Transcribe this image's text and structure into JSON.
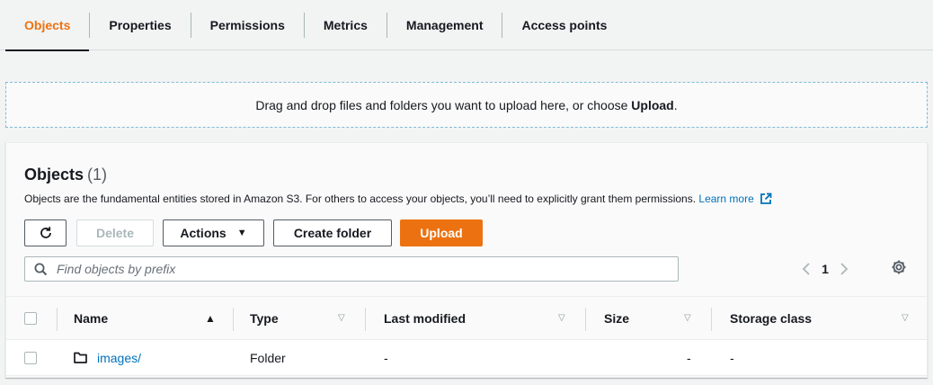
{
  "tabs": [
    {
      "label": "Objects"
    },
    {
      "label": "Properties"
    },
    {
      "label": "Permissions"
    },
    {
      "label": "Metrics"
    },
    {
      "label": "Management"
    },
    {
      "label": "Access points"
    }
  ],
  "dropzone": {
    "text": "Drag and drop files and folders you want to upload here, or choose ",
    "bold": "Upload",
    "suffix": "."
  },
  "objects": {
    "title": "Objects",
    "count": "(1)",
    "description": "Objects are the fundamental entities stored in Amazon S3. For others to access your objects, you’ll need to explicitly grant them permissions.",
    "learn_more": "Learn more",
    "buttons": {
      "delete": "Delete",
      "actions": "Actions",
      "create_folder": "Create folder",
      "upload": "Upload"
    },
    "search": {
      "placeholder": "Find objects by prefix",
      "value": ""
    },
    "pagination": {
      "page": "1"
    },
    "columns": {
      "name": "Name",
      "type": "Type",
      "last_modified": "Last modified",
      "size": "Size",
      "storage_class": "Storage class"
    },
    "rows": [
      {
        "name": "images/",
        "type": "Folder",
        "last_modified": "-",
        "size": "-",
        "storage_class": "-"
      }
    ]
  },
  "colors": {
    "accent": "#ec7211",
    "link": "#0073bb",
    "text": "#16191f"
  },
  "icons": [
    "refresh-icon",
    "caret-down-icon",
    "search-icon",
    "chevron-left-icon",
    "chevron-right-icon",
    "gear-icon",
    "external-link-icon",
    "folder-icon",
    "sort-up-icon",
    "sort-down-icon"
  ]
}
